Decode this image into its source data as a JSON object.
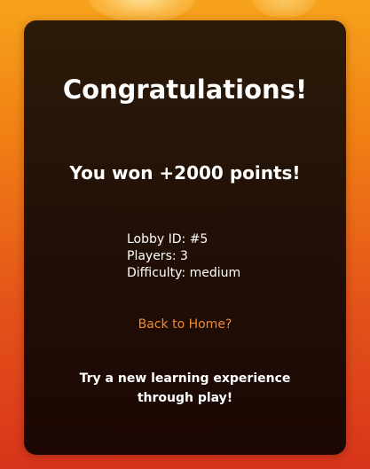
{
  "card": {
    "title": "Congratulations!",
    "result": "You won +2000 points!",
    "lobby": {
      "id_line": "Lobby ID: #5",
      "players_line": "Players: 3",
      "difficulty_line": "Difficulty: medium"
    },
    "home_link": "Back to Home?",
    "tagline": "Try a new learning experience through play!"
  },
  "colors": {
    "background_top": "#f7a21c",
    "background_bottom": "#d8341a",
    "card": "#221106",
    "link": "#f08a2c",
    "text": "#ffffff"
  }
}
